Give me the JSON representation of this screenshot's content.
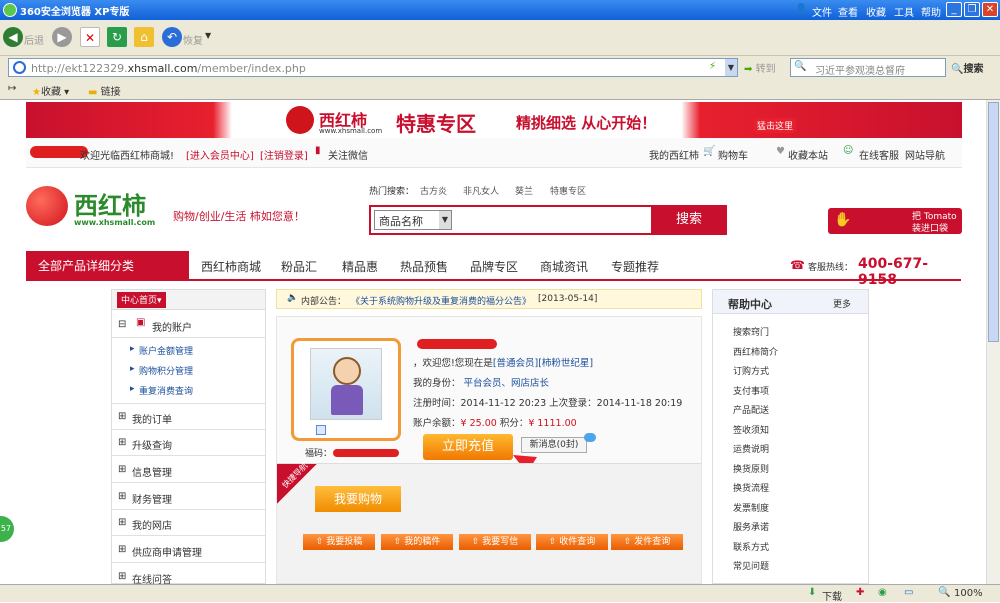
{
  "window": {
    "title": "360安全浏览器 XP专版",
    "menu": [
      "文件",
      "查看",
      "收藏",
      "工具",
      "帮助"
    ]
  },
  "toolbar": {
    "back": "后退",
    "forward": "恢复"
  },
  "address": {
    "url_prefix": "http://ekt122329.",
    "url_domain": "xhsmall.com",
    "url_path": "/member/index.php",
    "go": "转到",
    "search_placeholder": "习近平参观澳总督府",
    "search_btn": "搜索"
  },
  "favbar": {
    "favorites": "收藏",
    "links": "链接"
  },
  "banner": {
    "brand": "西红柿",
    "brand_url": "www.xhsmall.com",
    "slogan1": "特惠专区",
    "slogan2": "精挑细选 从心开始！",
    "cta": "猛击这里"
  },
  "topbar": {
    "welcome": "欢迎光临西红柿商城!",
    "member_center": "[进入会员中心]",
    "logout": "[注销登录]",
    "wechat": "关注微信",
    "my_store": "我的西红柿",
    "cart": "购物车",
    "fav": "收藏本站",
    "service": "在线客服",
    "site_nav": "网站导航"
  },
  "header": {
    "logo_text": "西红柿",
    "logo_url": "www.xhsmall.com",
    "tagline": "购物/创业/生活 柿如您意！",
    "hot_label": "热门搜索：",
    "hot": [
      "古方炎",
      "非凡女人",
      "葵兰",
      "特惠专区"
    ],
    "search_select": "商品名称",
    "search_btn": "搜索",
    "bag_line1": "把 Tomato",
    "bag_line2": "装进口袋"
  },
  "nav": {
    "all": "全部产品详细分类",
    "items": [
      "西红柿商城",
      "粉品汇",
      "精品惠",
      "热品预售",
      "品牌专区",
      "商城资讯",
      "专题推荐"
    ],
    "hotline_label": "客服热线：",
    "hotline": "400-677-9158"
  },
  "sidebar": {
    "tab": "中心首页",
    "groups": [
      {
        "label": "我的账户",
        "expanded": true,
        "subs": [
          "账户金额管理",
          "购物积分管理",
          "重复消费查询"
        ]
      },
      {
        "label": "我的订单"
      },
      {
        "label": "升级查询"
      },
      {
        "label": "信息管理"
      },
      {
        "label": "财务管理"
      },
      {
        "label": "我的网店"
      },
      {
        "label": "供应商申请管理"
      },
      {
        "label": "在线问答"
      }
    ]
  },
  "notice": {
    "label": "内部公告：",
    "text": "《关于系统购物升级及重复消费的福分公告》",
    "date": "[2013-05-14]"
  },
  "account": {
    "welcome_pre": "，欢迎您!您现在是",
    "level": "[普通会员][柿粉世纪星]",
    "identity_label": "我的身份：",
    "identity": "平台会员、网店店长",
    "reg_label": "注册时间：",
    "reg": "2014-11-12 20:23",
    "last_label": "上次登录：",
    "last": "2014-11-18 20:19",
    "balance_label": "账户余额：",
    "balance": "¥ 25.00",
    "points_label": "积分：",
    "points": "¥ 1111.00",
    "recharge": "立即充值",
    "newmsg": "新消息(0封)",
    "fuma": "福码：",
    "quick_tag": "快捷导航",
    "shop": "我要购物",
    "quick": [
      "我要投稿",
      "我的稿件",
      "我要写信",
      "收件查询",
      "发件查询"
    ]
  },
  "help": {
    "title": "帮助中心",
    "more": "更多",
    "items": [
      "搜索窍门",
      "西红柿简介",
      "订购方式",
      "支付事项",
      "产品配送",
      "签收须知",
      "运费说明",
      "换货原则",
      "换货流程",
      "发票制度",
      "服务承诺",
      "联系方式",
      "常见问题"
    ]
  },
  "status": {
    "download": "下载",
    "zoom": "100%"
  },
  "colors": {
    "brand": "#c8102e",
    "accent": "#f08c00",
    "link": "#1a4f9c"
  }
}
